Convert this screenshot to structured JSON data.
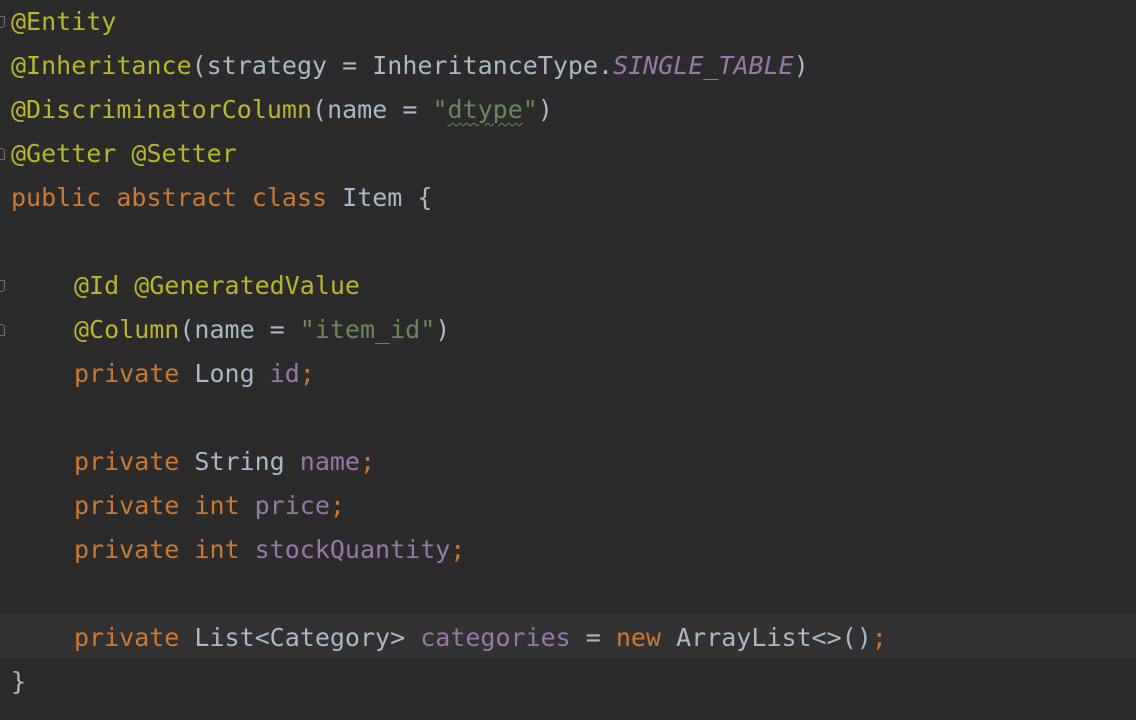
{
  "editor": {
    "lines": [
      {
        "segments": [
          {
            "t": "@Entity",
            "c": "ann"
          }
        ]
      },
      {
        "segments": [
          {
            "t": "@Inheritance",
            "c": "ann"
          },
          {
            "t": "(strategy = InheritanceType.",
            "c": "pl"
          },
          {
            "t": "SINGLE_TABLE",
            "c": "cst"
          },
          {
            "t": ")",
            "c": "pl"
          }
        ]
      },
      {
        "segments": [
          {
            "t": "@DiscriminatorColumn",
            "c": "ann"
          },
          {
            "t": "(name = ",
            "c": "pl"
          },
          {
            "t": "\"",
            "c": "str"
          },
          {
            "t": "dtype",
            "c": "str squig"
          },
          {
            "t": "\"",
            "c": "str"
          },
          {
            "t": ")",
            "c": "pl"
          }
        ]
      },
      {
        "segments": [
          {
            "t": "@Getter @Setter",
            "c": "ann"
          }
        ]
      },
      {
        "segments": [
          {
            "t": "public abstract class ",
            "c": "kw"
          },
          {
            "t": "Item {",
            "c": "pl"
          }
        ]
      },
      {
        "segments": []
      },
      {
        "indent": 1,
        "segments": [
          {
            "t": "@Id @GeneratedValue",
            "c": "ann"
          }
        ]
      },
      {
        "indent": 1,
        "segments": [
          {
            "t": "@Column",
            "c": "ann"
          },
          {
            "t": "(name = ",
            "c": "pl"
          },
          {
            "t": "\"item_id\"",
            "c": "str"
          },
          {
            "t": ")",
            "c": "pl"
          }
        ]
      },
      {
        "indent": 1,
        "segments": [
          {
            "t": "private ",
            "c": "kw"
          },
          {
            "t": "Long ",
            "c": "pl"
          },
          {
            "t": "id",
            "c": "fld"
          },
          {
            "t": ";",
            "c": "kw"
          }
        ]
      },
      {
        "segments": []
      },
      {
        "indent": 1,
        "segments": [
          {
            "t": "private ",
            "c": "kw"
          },
          {
            "t": "String ",
            "c": "pl"
          },
          {
            "t": "name",
            "c": "fld"
          },
          {
            "t": ";",
            "c": "kw"
          }
        ]
      },
      {
        "indent": 1,
        "segments": [
          {
            "t": "private int ",
            "c": "kw"
          },
          {
            "t": "price",
            "c": "fld"
          },
          {
            "t": ";",
            "c": "kw"
          }
        ]
      },
      {
        "indent": 1,
        "segments": [
          {
            "t": "private int ",
            "c": "kw"
          },
          {
            "t": "stockQuantity",
            "c": "fld"
          },
          {
            "t": ";",
            "c": "kw"
          }
        ]
      },
      {
        "segments": []
      },
      {
        "indent": 1,
        "segments": [
          {
            "t": "private ",
            "c": "kw"
          },
          {
            "t": "List<Category> ",
            "c": "pl"
          },
          {
            "t": "categories",
            "c": "fld"
          },
          {
            "t": " = ",
            "c": "pl"
          },
          {
            "t": "new ",
            "c": "kw"
          },
          {
            "t": "ArrayList<>()",
            "c": "pl"
          },
          {
            "t": ";",
            "c": "kw"
          }
        ]
      },
      {
        "segments": [
          {
            "t": "}",
            "c": "pl"
          }
        ]
      }
    ]
  },
  "colors": {
    "background": "#2b2b2b",
    "current_line": "#323232",
    "annotation": "#bbb529",
    "keyword": "#cc7832",
    "string": "#6a8759",
    "field": "#9876aa",
    "plain": "#a9b7c6"
  },
  "icons": {
    "fold_markers": [
      "fold-open-icon",
      "fold-close-icon",
      "fold-open-icon",
      "fold-close-icon"
    ]
  }
}
